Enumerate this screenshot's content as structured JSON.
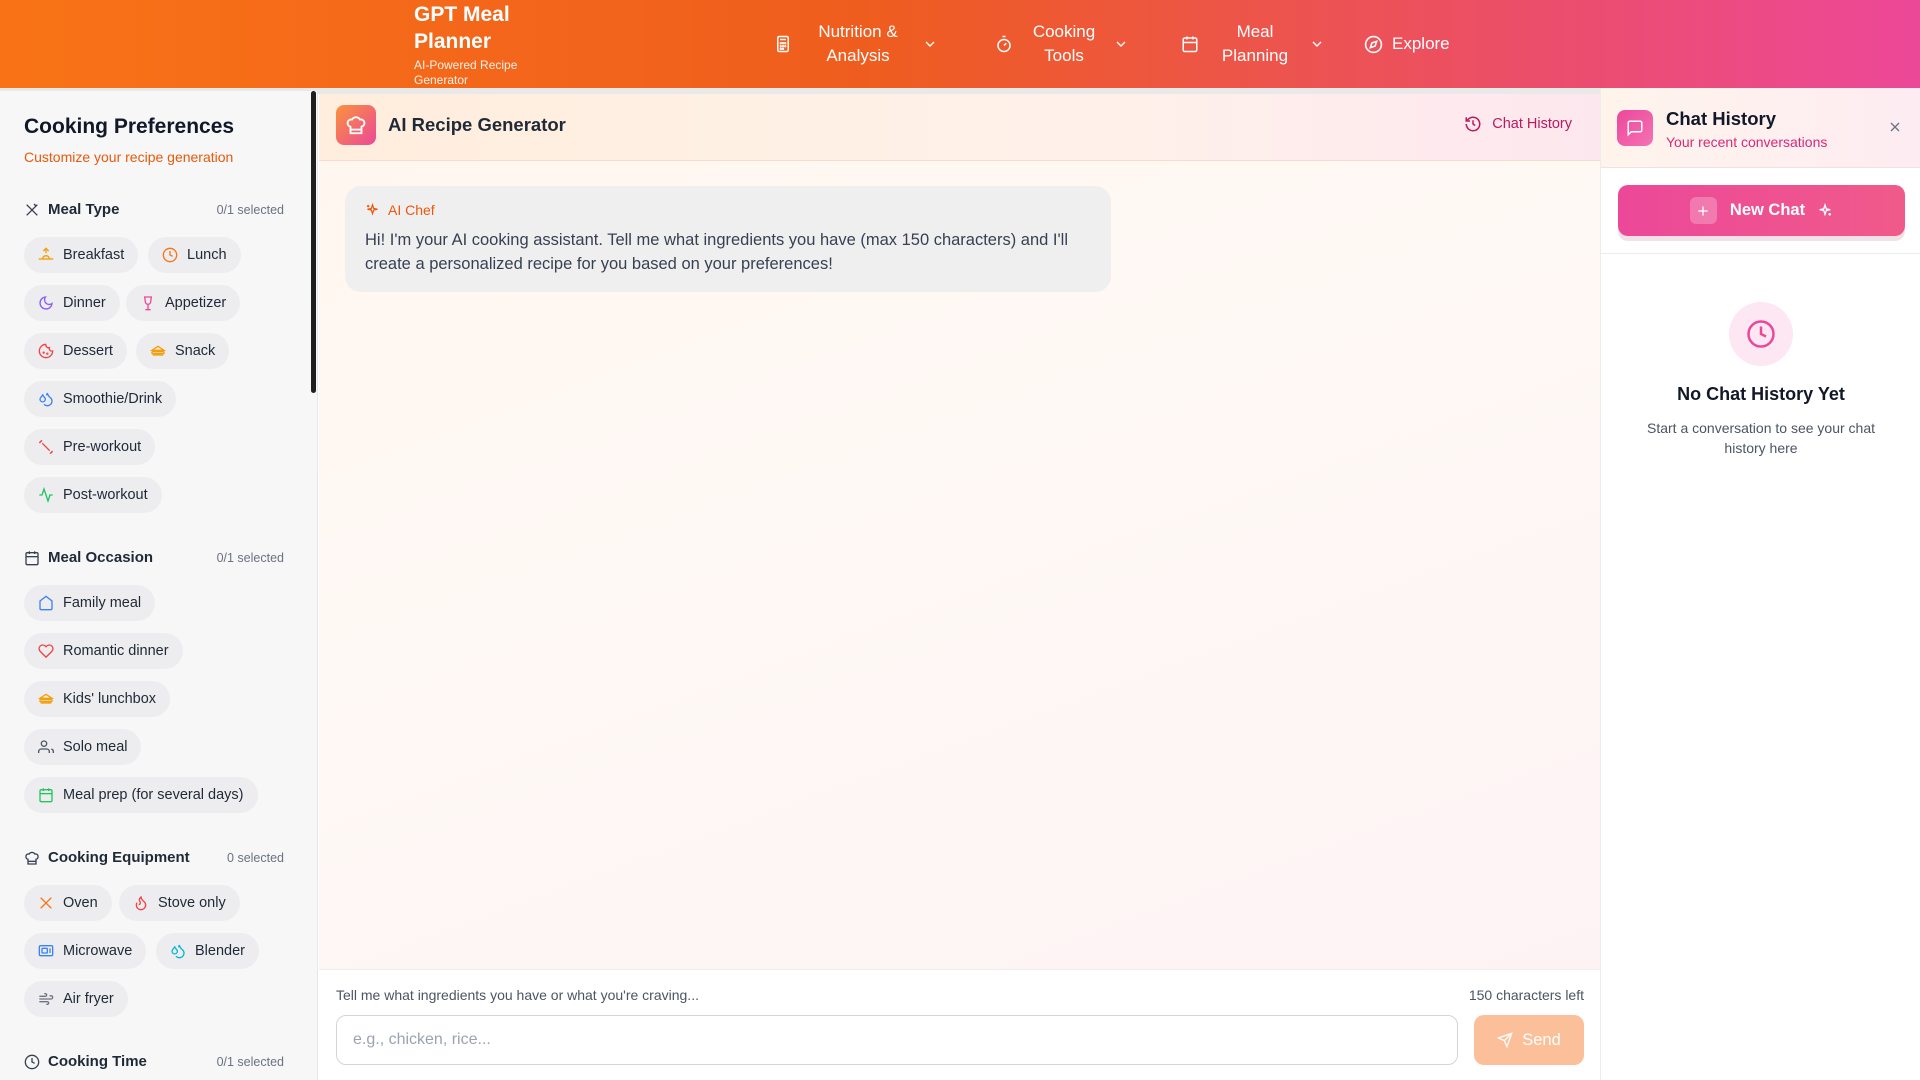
{
  "header": {
    "brand_title": "GPT Meal Planner",
    "brand_sub": "AI-Powered Recipe Generator",
    "nav": [
      {
        "label": "Nutrition & Analysis",
        "icon": "calculator-icon"
      },
      {
        "label": "Cooking Tools",
        "icon": "timer-icon"
      },
      {
        "label": "Meal Planning",
        "icon": "calendar-icon"
      },
      {
        "label": "Explore",
        "icon": "compass-icon"
      }
    ]
  },
  "sidebar": {
    "title": "Cooking Preferences",
    "subtitle": "Customize your recipe generation",
    "sections": [
      {
        "label": "Meal Type",
        "count": "0/1 selected",
        "chips": [
          "Breakfast",
          "Lunch",
          "Dinner",
          "Appetizer",
          "Dessert",
          "Snack",
          "Smoothie/Drink",
          "Pre-workout",
          "Post-workout"
        ]
      },
      {
        "label": "Meal Occasion",
        "count": "0/1 selected",
        "chips": [
          "Family meal",
          "Romantic dinner",
          "Kids' lunchbox",
          "Solo meal",
          "Meal prep (for several days)"
        ]
      },
      {
        "label": "Cooking Equipment",
        "count": "0 selected",
        "chips": [
          "Oven",
          "Stove only",
          "Microwave",
          "Blender",
          "Air fryer"
        ]
      },
      {
        "label": "Cooking Time",
        "count": "0/1 selected",
        "chips": []
      }
    ]
  },
  "main": {
    "title": "AI Recipe Generator",
    "history_link": "Chat History",
    "bubble_author": "AI Chef",
    "bubble_text": "Hi! I'm your AI cooking assistant. Tell me what ingredients you have (max 150 characters) and I'll create a personalized recipe for you based on your preferences!",
    "composer_hint": "Tell me what ingredients you have or what you're craving...",
    "chars_left": "150 characters left",
    "input_placeholder": "e.g., chicken, rice...",
    "send_label": "Send"
  },
  "history_panel": {
    "title": "Chat History",
    "subtitle": "Your recent conversations",
    "new_chat": "New Chat",
    "empty_title": "No Chat History Yet",
    "empty_text": "Start a conversation to see your chat history here"
  },
  "colors": {
    "accent_orange": "#f97316",
    "accent_pink": "#ec4899"
  }
}
